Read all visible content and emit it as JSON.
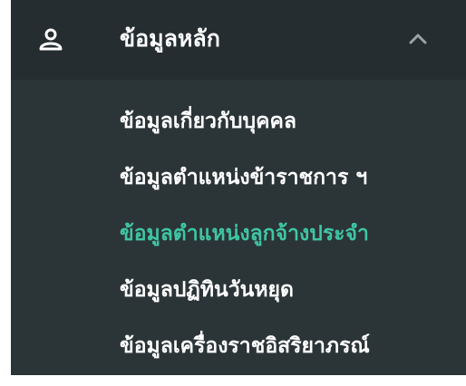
{
  "menu": {
    "header": {
      "icon": "user-icon",
      "label": "ข้อมูลหลัก",
      "chevron_icon": "chevron-up-icon"
    },
    "items": [
      {
        "label": "ข้อมูลเกี่ยวกับบุคคล",
        "active": false
      },
      {
        "label": "ข้อมูลตำแหน่งข้าราชการ ฯ",
        "active": false
      },
      {
        "label": "ข้อมูลตำแหน่งลูกจ้างประจำ",
        "active": true
      },
      {
        "label": "ข้อมูลปฏิทินวันหยุด",
        "active": false
      },
      {
        "label": "ข้อมูลเครื่องราชอิสริยาภรณ์",
        "active": false
      }
    ]
  },
  "colors": {
    "panel_background": "#2b3437",
    "header_background": "#252d30",
    "text": "#ffffff",
    "active_text": "#3fc5a4",
    "chevron": "#9aa3a6"
  }
}
